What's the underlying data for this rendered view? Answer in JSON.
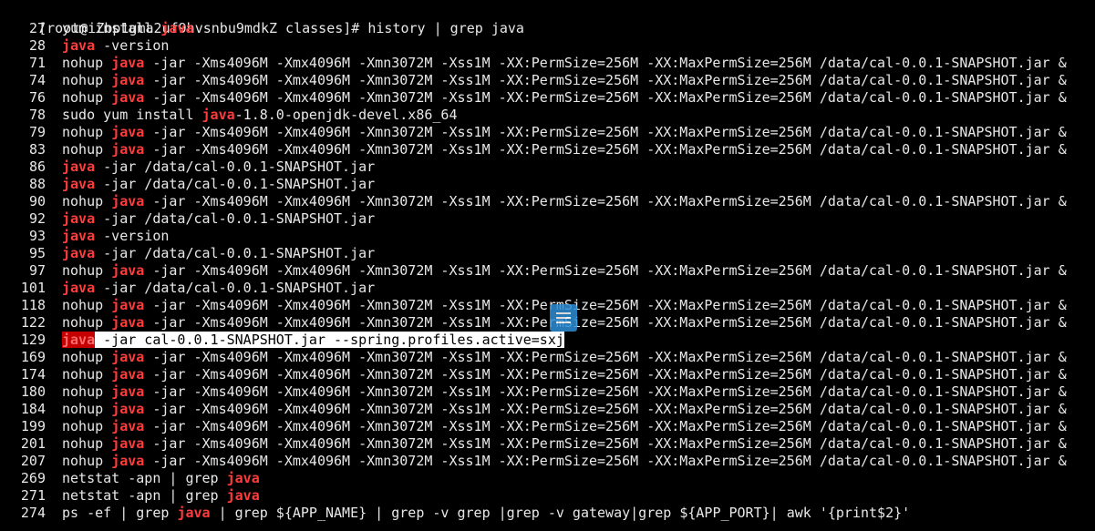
{
  "prompt": {
    "user": "[root@iZbp1gma2uf9hvsnbu9mdkZ classes]#",
    "command": "history | grep java"
  },
  "keyword": "java",
  "history": [
    {
      "num": "27",
      "pre": "yum install ",
      "post": ""
    },
    {
      "num": "28",
      "pre": "",
      "post": " -version"
    },
    {
      "num": "71",
      "pre": "nohup ",
      "post": " -jar -Xms4096M -Xmx4096M -Xmn3072M -Xss1M -XX:PermSize=256M -XX:MaxPermSize=256M /data/cal-0.0.1-SNAPSHOT.jar &"
    },
    {
      "num": "74",
      "pre": "nohup ",
      "post": " -jar -Xms4096M -Xmx4096M -Xmn3072M -Xss1M -XX:PermSize=256M -XX:MaxPermSize=256M /data/cal-0.0.1-SNAPSHOT.jar &"
    },
    {
      "num": "76",
      "pre": "nohup ",
      "post": " -jar -Xms4096M -Xmx4096M -Xmn3072M -Xss1M -XX:PermSize=256M -XX:MaxPermSize=256M /data/cal-0.0.1-SNAPSHOT.jar &"
    },
    {
      "num": "78",
      "pre": "sudo yum install ",
      "post": "-1.8.0-openjdk-devel.x86_64"
    },
    {
      "num": "79",
      "pre": "nohup ",
      "post": " -jar -Xms4096M -Xmx4096M -Xmn3072M -Xss1M -XX:PermSize=256M -XX:MaxPermSize=256M /data/cal-0.0.1-SNAPSHOT.jar &"
    },
    {
      "num": "83",
      "pre": "nohup ",
      "post": " -jar -Xms4096M -Xmx4096M -Xmn3072M -Xss1M -XX:PermSize=256M -XX:MaxPermSize=256M /data/cal-0.0.1-SNAPSHOT.jar &"
    },
    {
      "num": "86",
      "pre": "",
      "post": " -jar /data/cal-0.0.1-SNAPSHOT.jar"
    },
    {
      "num": "88",
      "pre": "",
      "post": " -jar /data/cal-0.0.1-SNAPSHOT.jar"
    },
    {
      "num": "90",
      "pre": "nohup ",
      "post": " -jar -Xms4096M -Xmx4096M -Xmn3072M -Xss1M -XX:PermSize=256M -XX:MaxPermSize=256M /data/cal-0.0.1-SNAPSHOT.jar &"
    },
    {
      "num": "92",
      "pre": "",
      "post": " -jar /data/cal-0.0.1-SNAPSHOT.jar"
    },
    {
      "num": "93",
      "pre": "",
      "post": " -version"
    },
    {
      "num": "95",
      "pre": "",
      "post": " -jar /data/cal-0.0.1-SNAPSHOT.jar"
    },
    {
      "num": "97",
      "pre": "nohup ",
      "post": " -jar -Xms4096M -Xmx4096M -Xmn3072M -Xss1M -XX:PermSize=256M -XX:MaxPermSize=256M /data/cal-0.0.1-SNAPSHOT.jar &"
    },
    {
      "num": "101",
      "pre": "",
      "post": " -jar /data/cal-0.0.1-SNAPSHOT.jar"
    },
    {
      "num": "118",
      "pre": "nohup ",
      "post": " -jar -Xms4096M -Xmx4096M -Xmn3072M -Xss1M -XX:PermSize=256M -XX:MaxPermSize=256M /data/cal-0.0.1-SNAPSHOT.jar &"
    },
    {
      "num": "122",
      "pre": "nohup ",
      "post": " -jar -Xms4096M -Xmx4096M -Xmn3072M -Xss1M -XX:PermSize=256M -XX:MaxPermSize=256M /data/cal-0.0.1-SNAPSHOT.jar &"
    },
    {
      "num": "129",
      "pre": "",
      "post": " -jar cal-0.0.1-SNAPSHOT.jar --spring.profiles.active=sxj",
      "selected": true
    },
    {
      "num": "169",
      "pre": "nohup ",
      "post": " -jar -Xms4096M -Xmx4096M -Xmn3072M -Xss1M -XX:PermSize=256M -XX:MaxPermSize=256M /data/cal-0.0.1-SNAPSHOT.jar &"
    },
    {
      "num": "174",
      "pre": "nohup ",
      "post": " -jar -Xms4096M -Xmx4096M -Xmn3072M -Xss1M -XX:PermSize=256M -XX:MaxPermSize=256M /data/cal-0.0.1-SNAPSHOT.jar &"
    },
    {
      "num": "180",
      "pre": "nohup ",
      "post": " -jar -Xms4096M -Xmx4096M -Xmn3072M -Xss1M -XX:PermSize=256M -XX:MaxPermSize=256M /data/cal-0.0.1-SNAPSHOT.jar &"
    },
    {
      "num": "184",
      "pre": "nohup ",
      "post": " -jar -Xms4096M -Xmx4096M -Xmn3072M -Xss1M -XX:PermSize=256M -XX:MaxPermSize=256M /data/cal-0.0.1-SNAPSHOT.jar &"
    },
    {
      "num": "199",
      "pre": "nohup ",
      "post": " -jar -Xms4096M -Xmx4096M -Xmn3072M -Xss1M -XX:PermSize=256M -XX:MaxPermSize=256M /data/cal-0.0.1-SNAPSHOT.jar &"
    },
    {
      "num": "201",
      "pre": "nohup ",
      "post": " -jar -Xms4096M -Xmx4096M -Xmn3072M -Xss1M -XX:PermSize=256M -XX:MaxPermSize=256M /data/cal-0.0.1-SNAPSHOT.jar &"
    },
    {
      "num": "207",
      "pre": "nohup ",
      "post": " -jar -Xms4096M -Xmx4096M -Xmn3072M -Xss1M -XX:PermSize=256M -XX:MaxPermSize=256M /data/cal-0.0.1-SNAPSHOT.jar &"
    },
    {
      "num": "269",
      "pre": "netstat -apn | grep ",
      "post": ""
    },
    {
      "num": "271",
      "pre": "netstat -apn | grep ",
      "post": ""
    },
    {
      "num": "274",
      "pre": "ps -ef | grep ",
      "post": " | grep ${APP_NAME} | grep -v grep |grep -v gateway|grep ${APP_PORT}| awk '{print$2}'"
    }
  ],
  "colors": {
    "background": "#000000",
    "text": "#e8e8e8",
    "keyword": "#ff3b3b",
    "selection": "#ffffff",
    "widget": "#2d8fd6"
  },
  "icons": {
    "floating_widget": "menu-lines-icon"
  }
}
